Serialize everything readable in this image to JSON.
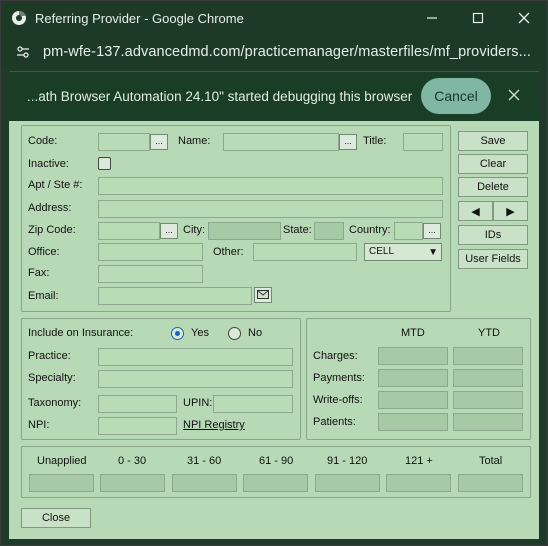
{
  "window": {
    "title": "Referring Provider - Google Chrome",
    "url": "pm-wfe-137.advancedmd.com/practicemanager/masterfiles/mf_providers..."
  },
  "infobar": {
    "message": "...ath Browser Automation 24.10\" started debugging this browser",
    "cancel_label": "Cancel"
  },
  "provider": {
    "code_label": "Code:",
    "name_label": "Name:",
    "title_label": "Title:",
    "inactive_label": "Inactive:",
    "apt_label": "Apt / Ste #:",
    "address_label": "Address:",
    "zip_label": "Zip Code:",
    "city_label": "City:",
    "state_label": "State:",
    "country_label": "Country:",
    "office_label": "Office:",
    "other_label": "Other:",
    "phone_type": "CELL",
    "fax_label": "Fax:",
    "email_label": "Email:",
    "picker_label": "..."
  },
  "actions": {
    "save": "Save",
    "clear": "Clear",
    "delete": "Delete",
    "ids": "IDs",
    "user_fields": "User Fields",
    "close": "Close"
  },
  "insurance": {
    "include_label": "Include on Insurance:",
    "yes_label": "Yes",
    "no_label": "No",
    "selected": "Yes",
    "practice_label": "Practice:",
    "specialty_label": "Specialty:",
    "taxonomy_label": "Taxonomy:",
    "upin_label": "UPIN:",
    "npi_label": "NPI:",
    "npi_registry_label": "NPI Registry"
  },
  "stats": {
    "mtd_label": "MTD",
    "ytd_label": "YTD",
    "charges_label": "Charges:",
    "payments_label": "Payments:",
    "writeoffs_label": "Write-offs:",
    "patients_label": "Patients:"
  },
  "aging": {
    "headers": [
      "Unapplied",
      "0 - 30",
      "31 - 60",
      "61 - 90",
      "91 - 120",
      "121 +",
      "Total"
    ]
  }
}
